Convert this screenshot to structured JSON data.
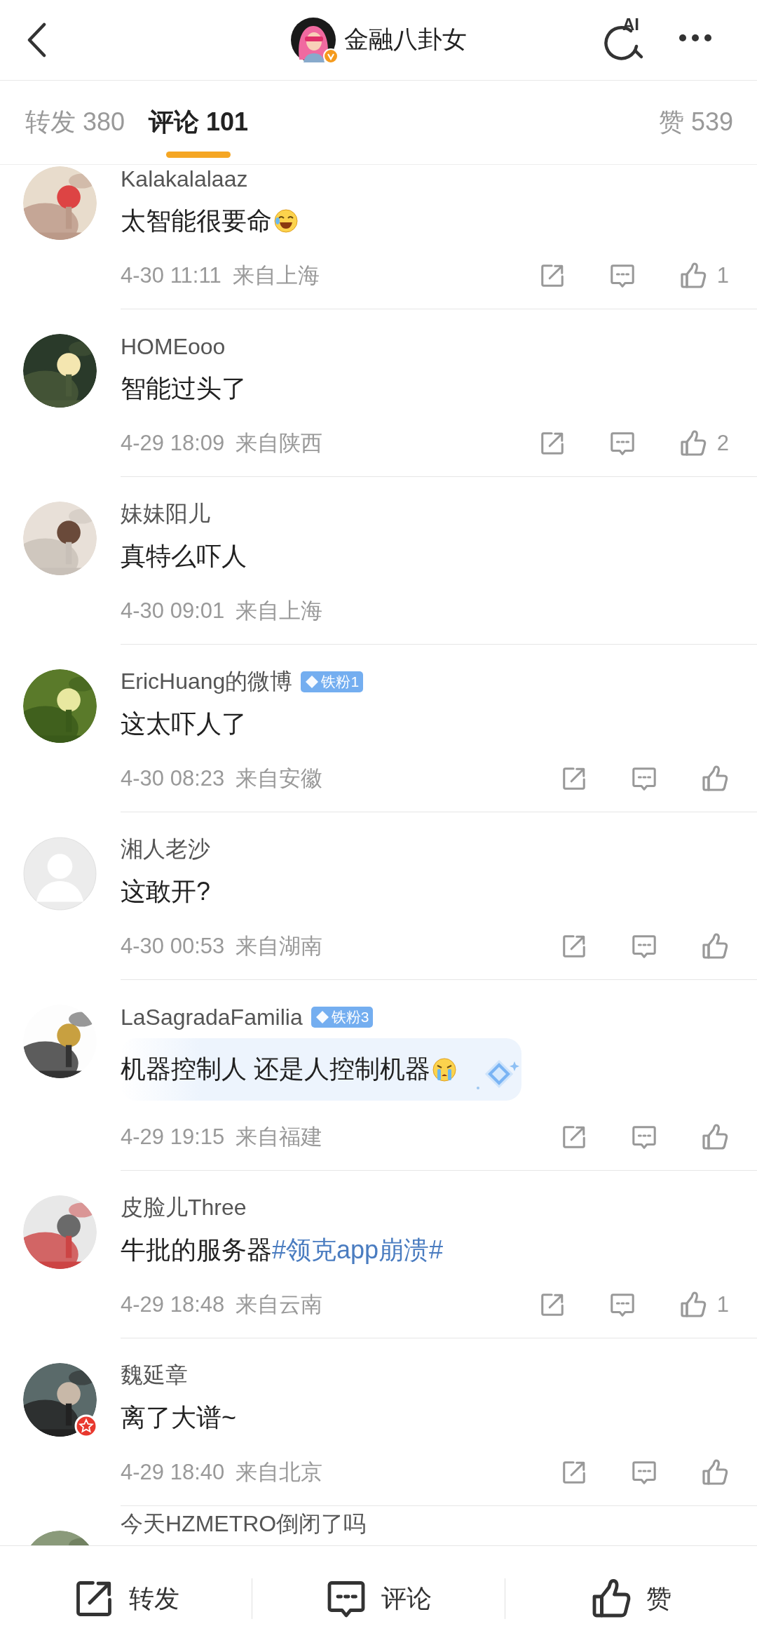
{
  "header": {
    "title": "金融八卦女",
    "verified": true,
    "ai_label": "AI"
  },
  "tabs": [
    {
      "label": "转发 380",
      "selected": false
    },
    {
      "label": "评论 101",
      "selected": true
    },
    {
      "label": "赞 539",
      "selected": false
    }
  ],
  "comments": [
    {
      "name": "Kalakalalaaz",
      "content": "太智能很要命",
      "emoji": {
        "kind": "laugh"
      },
      "time": "4-30 11:11",
      "location": "来自上海",
      "actions": true,
      "likes": "1"
    },
    {
      "name": "HOMEooo",
      "content": "智能过头了",
      "time": "4-29 18:09",
      "location": "来自陕西",
      "actions": true,
      "likes": "2"
    },
    {
      "name": "妹妹阳儿",
      "content": "真特么吓人",
      "time": "4-30 09:01",
      "location": "来自上海",
      "actions": false
    },
    {
      "name": "EricHuang的微博",
      "badge": "铁粉1",
      "content": "这太吓人了",
      "time": "4-30 08:23",
      "location": "来自安徽",
      "actions": true
    },
    {
      "avatar": {
        "kind": "default"
      },
      "name": "湘人老沙",
      "content": "这敢开?",
      "time": "4-30 00:53",
      "location": "来自湖南",
      "actions": true
    },
    {
      "name": "LaSagradaFamilia",
      "badge": "铁粉3",
      "content": "机器控制人 还是人控制机器",
      "emoji": {
        "kind": "cry"
      },
      "bubble": true,
      "time": "4-29 19:15",
      "location": "来自福建",
      "actions": true
    },
    {
      "name": "皮脸儿Three",
      "content": "牛批的服务器",
      "hashtag": "#领克app崩溃#",
      "time": "4-29 18:48",
      "location": "来自云南",
      "actions": true,
      "likes": "1"
    },
    {
      "avatar_badge": true,
      "name": "魏延章",
      "content": "离了大谱~",
      "time": "4-29 18:40",
      "location": "来自北京",
      "actions": true
    },
    {
      "name": "今天HZMETRO倒闭了吗"
    }
  ],
  "bottom_bar": [
    {
      "kind": "share",
      "label": "转发"
    },
    {
      "kind": "comment",
      "label": "评论"
    },
    {
      "kind": "like",
      "label": "赞"
    }
  ]
}
